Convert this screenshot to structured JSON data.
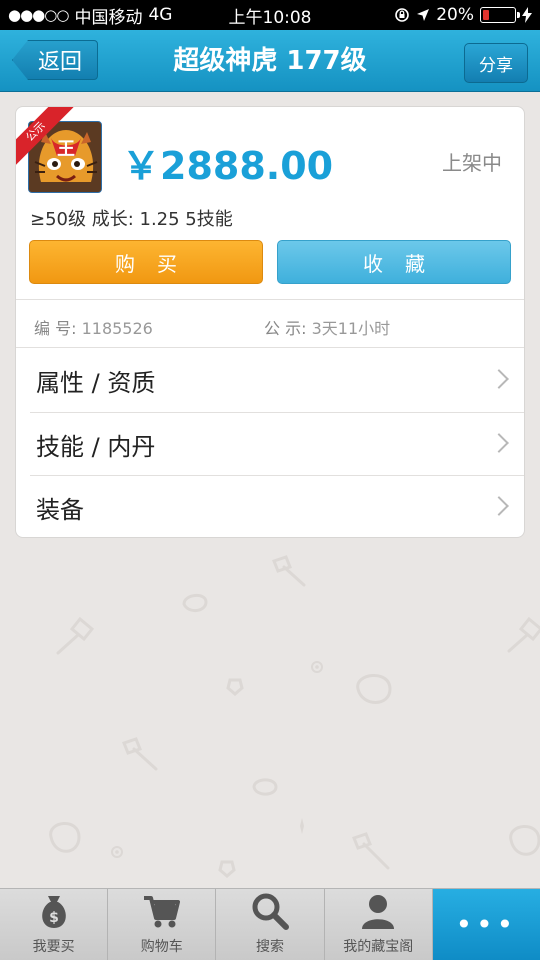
{
  "status_bar": {
    "signal": "●●●○○",
    "carrier": "中国移动",
    "network": "4G",
    "time": "上午10:08",
    "battery": "20%",
    "battery_level": 0.2
  },
  "nav": {
    "back_label": "返回",
    "title": "超级神虎 177级",
    "share_label": "分享"
  },
  "item": {
    "ribbon": "公示",
    "price": "￥2888.00",
    "status": "上架中",
    "summary": "≥50级  成长: 1.25   5技能",
    "buy_label": "购买",
    "favorite_label": "收藏",
    "id_label": "编  号:",
    "id_value": "1185526",
    "notice_label": "公  示:",
    "notice_value": "3天11小时"
  },
  "sections": [
    {
      "label": "属性 / 资质"
    },
    {
      "label": "技能 / 内丹"
    },
    {
      "label": "装备"
    }
  ],
  "tabbar": {
    "items": [
      {
        "label": "我要买",
        "icon": "money-bag-icon"
      },
      {
        "label": "购物车",
        "icon": "cart-icon"
      },
      {
        "label": "搜索",
        "icon": "search-icon"
      },
      {
        "label": "我的藏宝阁",
        "icon": "user-icon"
      }
    ],
    "more_label": "•••"
  },
  "colors": {
    "nav_blue": "#1a9ecf",
    "price_blue": "#1aa0d8",
    "buy_orange": "#f4a21c",
    "favorite_blue": "#4ab5df",
    "ribbon_red": "#d9232a"
  }
}
